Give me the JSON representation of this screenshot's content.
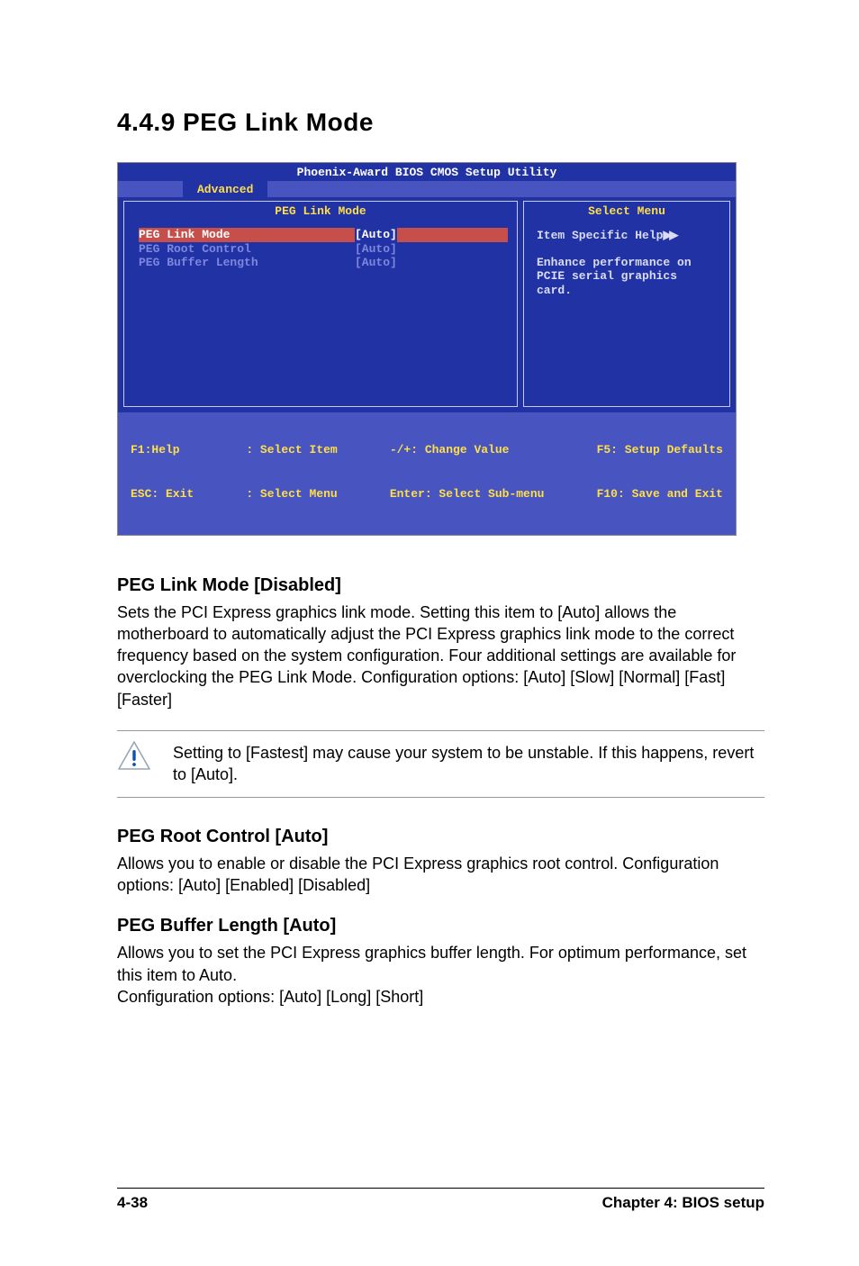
{
  "section_number_title": "4.4.9   PEG Link Mode",
  "bios": {
    "title": "Phoenix-Award BIOS CMOS Setup Utility",
    "tab": "Advanced",
    "left_panel_title": "PEG Link Mode",
    "right_panel_title": "Select Menu",
    "items": [
      {
        "label": "PEG Link Mode",
        "value": "[Auto]"
      },
      {
        "label": "PEG Root Control",
        "value": "[Auto]"
      },
      {
        "label": "PEG Buffer Length",
        "value": "[Auto]"
      }
    ],
    "help_header": "Item Specific Help",
    "help_text": "Enhance performance on PCIE serial graphics card.",
    "footer": {
      "c1a": "F1:Help",
      "c1b": "ESC: Exit",
      "c2a": ": Select Item",
      "c2b": ": Select Menu",
      "c3a": "-/+: Change Value",
      "c3b": "Enter: Select Sub-menu",
      "c4a": "F5: Setup Defaults",
      "c4b": "F10: Save and Exit"
    }
  },
  "section1": {
    "heading": "PEG Link Mode [Disabled]",
    "body": "Sets the PCI Express graphics link mode. Setting this item to [Auto] allows the motherboard to automatically adjust the PCI Express graphics link mode to the correct frequency based on the system configuration. Four additional settings are available for overclocking the PEG Link Mode. Configuration options: [Auto] [Slow] [Normal] [Fast] [Faster]"
  },
  "note": "Setting to [Fastest] may cause your system to be unstable. If this happens, revert to [Auto].",
  "section2": {
    "heading": "PEG Root Control [Auto]",
    "body": "Allows you to enable or disable the PCI Express graphics root control. Configuration options: [Auto] [Enabled] [Disabled]"
  },
  "section3": {
    "heading": "PEG Buffer Length [Auto]",
    "body": "Allows you to set the PCI Express graphics buffer length. For optimum performance, set this item to Auto.\nConfiguration options: [Auto] [Long] [Short]"
  },
  "footer": {
    "left": "4-38",
    "right": "Chapter 4: BIOS setup"
  }
}
